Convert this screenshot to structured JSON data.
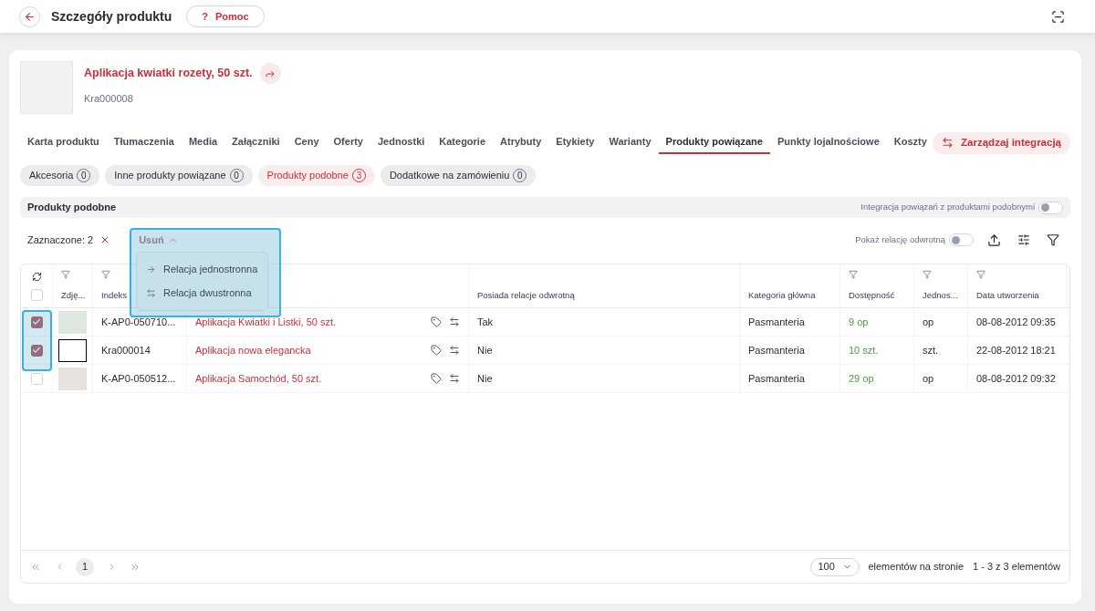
{
  "header": {
    "title": "Szczegóły produktu",
    "help_icon": "?",
    "help_label": "Pomoc"
  },
  "product": {
    "name": "Aplikacja kwiatki rozety, 50 szt.",
    "code": "Kra000008"
  },
  "tabs": [
    {
      "label": "Karta produktu",
      "selected": false
    },
    {
      "label": "Tłumaczenia",
      "selected": false
    },
    {
      "label": "Media",
      "selected": false
    },
    {
      "label": "Załączniki",
      "selected": false
    },
    {
      "label": "Ceny",
      "selected": false
    },
    {
      "label": "Oferty",
      "selected": false
    },
    {
      "label": "Jednostki",
      "selected": false
    },
    {
      "label": "Kategorie",
      "selected": false
    },
    {
      "label": "Atrybuty",
      "selected": false
    },
    {
      "label": "Etykiety",
      "selected": false
    },
    {
      "label": "Warianty",
      "selected": false
    },
    {
      "label": "Produkty powiązane",
      "selected": true
    },
    {
      "label": "Punkty lojalnościowe",
      "selected": false
    },
    {
      "label": "Koszty",
      "selected": false
    }
  ],
  "manage_button": "Zarządzaj integracją",
  "subtabs": [
    {
      "label": "Akcesoria",
      "count": "0",
      "selected": false
    },
    {
      "label": "Inne produkty powiązane",
      "count": "0",
      "selected": false
    },
    {
      "label": "Produkty podobne",
      "count": "3",
      "selected": true
    },
    {
      "label": "Dodatkowe na zamówieniu",
      "count": "0",
      "selected": false
    }
  ],
  "section": {
    "title": "Produkty podobne",
    "integration_label": "Integracja powiązań z produktami podobnymi",
    "integration_on": false
  },
  "toolbar": {
    "selected_label": "Zaznaczone: 2",
    "action": "Usuń",
    "reverse_label": "Pokaż relację odwrotną",
    "reverse_on": false
  },
  "menu": [
    {
      "kind": "one_way",
      "label": "Relacja jednostronna"
    },
    {
      "kind": "two_way",
      "label": "Relacja dwustronna"
    }
  ],
  "table": {
    "all_checked": false,
    "columns": [
      {
        "label": "Zdję...",
        "filter": true
      },
      {
        "label": "Indeks",
        "filter": true
      },
      {
        "filter": false
      },
      {
        "label": "Posiada relacje odwrotną",
        "filter": false
      },
      {
        "label": "Kategoria główna",
        "filter": false
      },
      {
        "label": "Dostępność",
        "filter": true
      },
      {
        "label": "Jednos...",
        "filter": true
      },
      {
        "label": "Data utworzenia",
        "filter": true
      }
    ],
    "rows": [
      {
        "selected": true,
        "index": "K-AP0-050710...",
        "name": "Aplikacja Kwiatki i Listki, 50 szt.",
        "reverse": "Tak",
        "category": "Pasmanteria",
        "availability": "9 op",
        "unit": "op",
        "created": "08-08-2012 09:35"
      },
      {
        "selected": true,
        "index": "Kra000014",
        "name": "Aplikacja nowa elegancka",
        "reverse": "Nie",
        "category": "Pasmanteria",
        "availability": "10 szt.",
        "unit": "szt.",
        "created": "22-08-2012 18:21"
      },
      {
        "selected": false,
        "index": "K-AP0-050512...",
        "name": "Aplikacja Samochód, 50 szt.",
        "reverse": "Nie",
        "category": "Pasmanteria",
        "availability": "29 op",
        "unit": "op",
        "created": "08-08-2012 09:32"
      }
    ]
  },
  "pagination": {
    "page": "1",
    "per_page": "100",
    "per_page_label": "elementów na stronie",
    "range": "1 - 3 z 3 elementów"
  }
}
